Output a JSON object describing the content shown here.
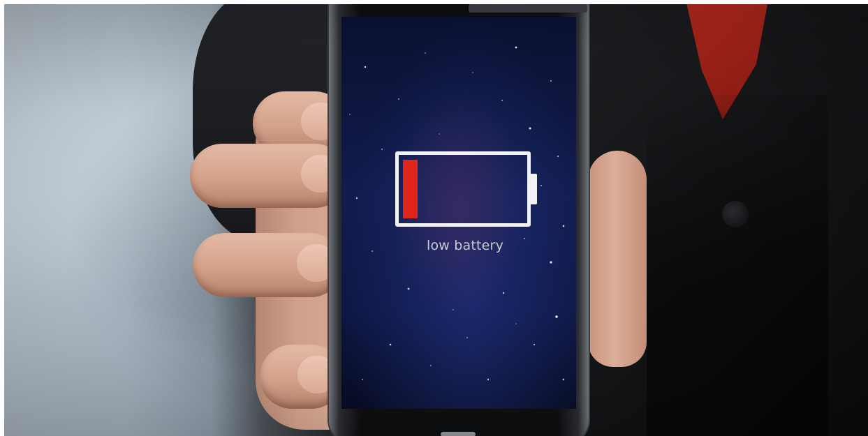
{
  "phone_screen": {
    "battery_label": "low battery",
    "battery_level": 0.12,
    "battery_fill_color": "#e0261b",
    "battery_outline_color": "#f2f2f2"
  }
}
